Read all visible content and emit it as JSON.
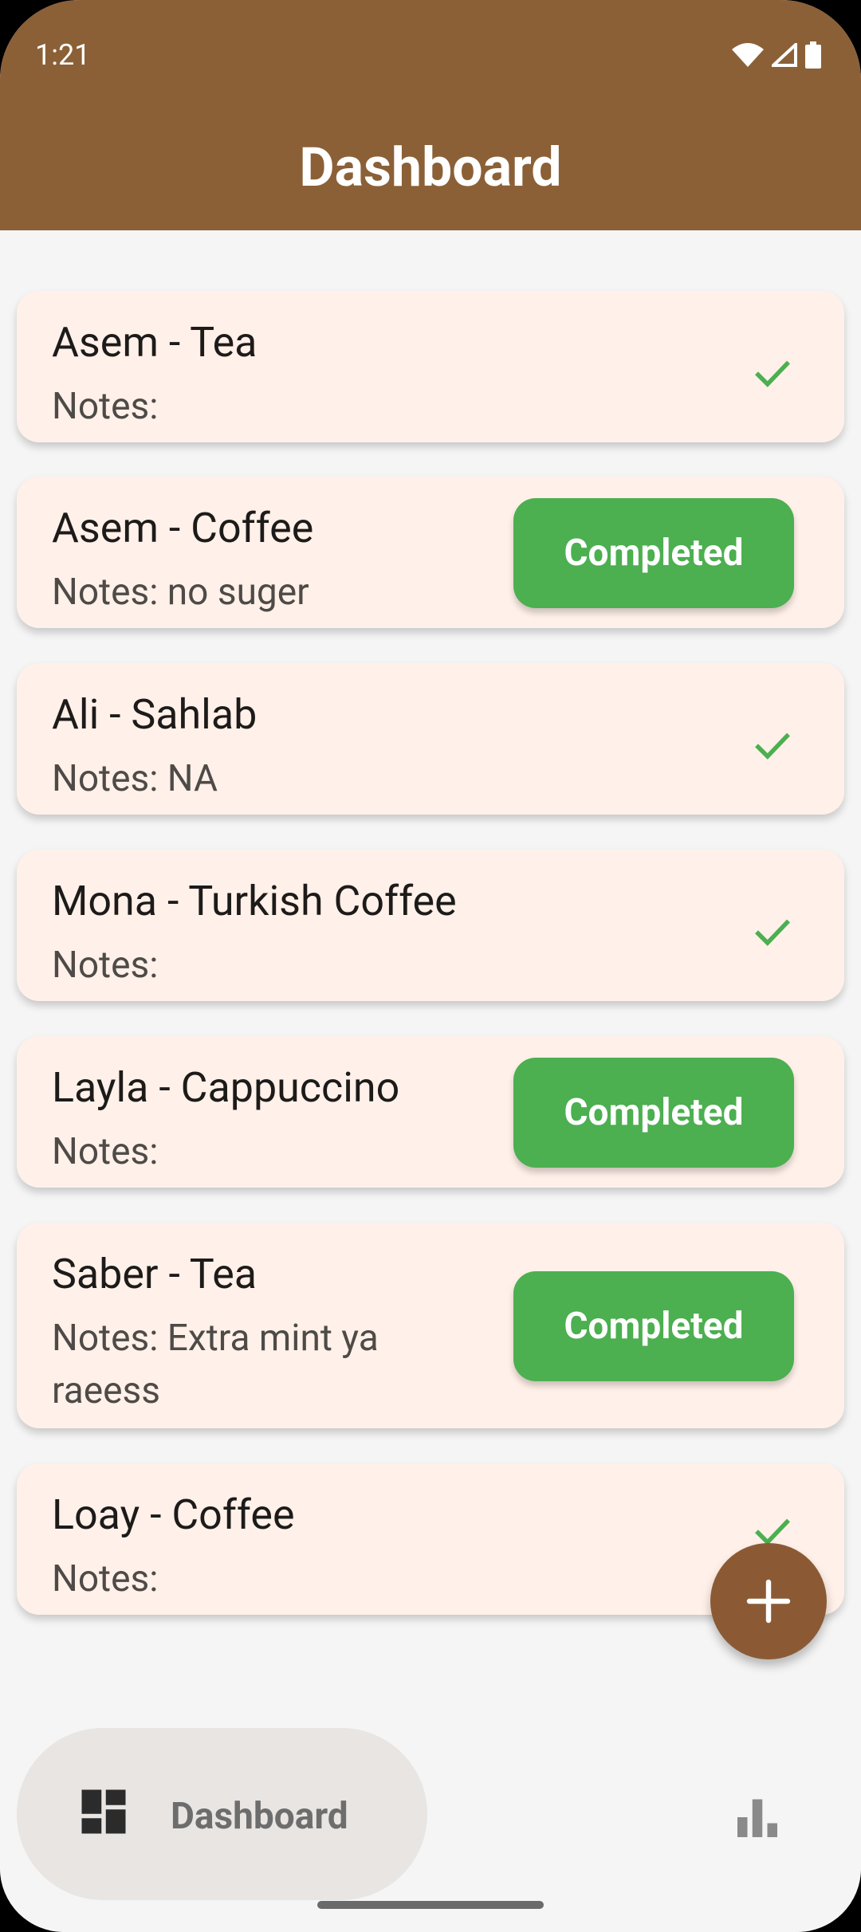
{
  "status": {
    "time": "1:21"
  },
  "appbar": {
    "title": "Dashboard"
  },
  "orders": [
    {
      "name": "Asem - Tea",
      "notes": "Notes:",
      "state": "done"
    },
    {
      "name": "Asem - Coffee",
      "notes": "Notes: no suger",
      "state": "pending",
      "button": "Completed"
    },
    {
      "name": "Ali - Sahlab",
      "notes": "Notes: NA",
      "state": "done"
    },
    {
      "name": "Mona - Turkish Coffee",
      "notes": "Notes:",
      "state": "done"
    },
    {
      "name": "Layla - Cappuccino",
      "notes": "Notes:",
      "state": "pending",
      "button": "Completed"
    },
    {
      "name": "Saber - Tea",
      "notes_line1": "Notes: Extra mint ya",
      "notes_line2": "raeess",
      "state": "pending",
      "button": "Completed"
    },
    {
      "name": "Loay - Coffee",
      "notes": "Notes:",
      "state": "done"
    }
  ],
  "nav": {
    "dashboard_label": "Dashboard"
  },
  "colors": {
    "appbar": "#8b6037",
    "card": "#fff1e9",
    "completed": "#4caf50",
    "fab": "#8b5a34"
  },
  "icons": {
    "status": [
      "wifi-icon",
      "signal-icon",
      "battery-icon"
    ],
    "check": "check-icon",
    "fab": "plus-icon",
    "nav": [
      "dashboard-icon",
      "bar-chart-icon"
    ]
  }
}
